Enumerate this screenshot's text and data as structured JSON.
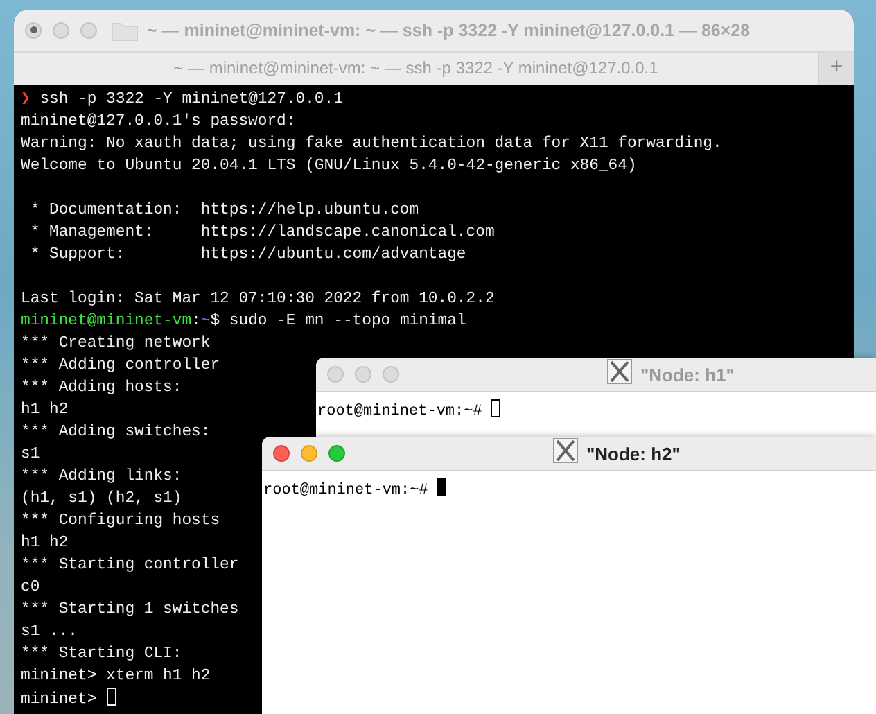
{
  "terminal": {
    "title": "~ — mininet@mininet-vm: ~ — ssh -p 3322 -Y mininet@127.0.0.1 — 86×28",
    "traffic_lights_active": false,
    "tab": {
      "label": "~ — mininet@mininet-vm: ~ — ssh -p 3322 -Y mininet@127.0.0.1",
      "selected": true
    },
    "new_tab_button": "+",
    "lines": [
      {
        "kind": "local-prompt",
        "symbol": "❯",
        "command": " ssh -p 3322 -Y mininet@127.0.0.1"
      },
      {
        "kind": "text",
        "text": "mininet@127.0.0.1's password:"
      },
      {
        "kind": "text",
        "text": "Warning: No xauth data; using fake authentication data for X11 forwarding."
      },
      {
        "kind": "text",
        "text": "Welcome to Ubuntu 20.04.1 LTS (GNU/Linux 5.4.0-42-generic x86_64)"
      },
      {
        "kind": "blank"
      },
      {
        "kind": "text",
        "text": " * Documentation:  https://help.ubuntu.com"
      },
      {
        "kind": "text",
        "text": " * Management:     https://landscape.canonical.com"
      },
      {
        "kind": "text",
        "text": " * Support:        https://ubuntu.com/advantage"
      },
      {
        "kind": "blank"
      },
      {
        "kind": "text",
        "text": "Last login: Sat Mar 12 07:10:30 2022 from 10.0.2.2"
      },
      {
        "kind": "remote-prompt",
        "user_host": "mininet@mininet-vm",
        "separator": ":",
        "path": "~",
        "symbol": "$",
        "command": " sudo -E mn --topo minimal"
      },
      {
        "kind": "text",
        "text": "*** Creating network"
      },
      {
        "kind": "text",
        "text": "*** Adding controller"
      },
      {
        "kind": "text",
        "text": "*** Adding hosts:"
      },
      {
        "kind": "text",
        "text": "h1 h2"
      },
      {
        "kind": "text",
        "text": "*** Adding switches:"
      },
      {
        "kind": "text",
        "text": "s1"
      },
      {
        "kind": "text",
        "text": "*** Adding links:"
      },
      {
        "kind": "text",
        "text": "(h1, s1) (h2, s1)"
      },
      {
        "kind": "text",
        "text": "*** Configuring hosts"
      },
      {
        "kind": "text",
        "text": "h1 h2"
      },
      {
        "kind": "text",
        "text": "*** Starting controller"
      },
      {
        "kind": "text",
        "text": "c0"
      },
      {
        "kind": "text",
        "text": "*** Starting 1 switches"
      },
      {
        "kind": "text",
        "text": "s1 ..."
      },
      {
        "kind": "text",
        "text": "*** Starting CLI:"
      },
      {
        "kind": "text",
        "text": "mininet> xterm h1 h2"
      },
      {
        "kind": "text",
        "text": "mininet> ",
        "cursor_filled": false
      }
    ]
  },
  "xterms": [
    {
      "title": "\"Node: h1\"",
      "active": false,
      "prompt": "root@mininet-vm:~# ",
      "cursor_filled": false
    },
    {
      "title": "\"Node: h2\"",
      "active": true,
      "prompt": "root@mininet-vm:~# ",
      "cursor_filled": true
    }
  ]
}
